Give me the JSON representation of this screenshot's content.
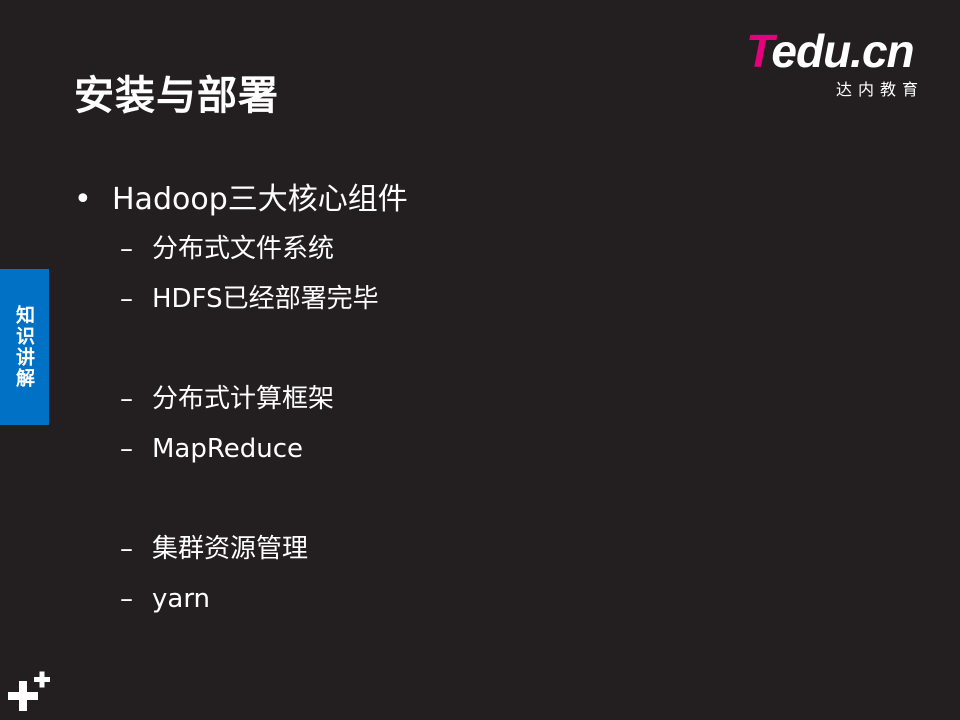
{
  "slide": {
    "title": "安装与部署",
    "side_tab": "知识讲解",
    "logo": {
      "word_first": "T",
      "word_rest": "edu.cn",
      "subtitle": "达内教育",
      "brand_color": "#e6007e"
    },
    "bullet": {
      "symbol": "•",
      "text": "Hadoop三大核心组件"
    },
    "sub_items": [
      {
        "dash": "–",
        "text": "分布式文件系统"
      },
      {
        "dash": "–",
        "text": "HDFS已经部署完毕"
      },
      {
        "dash": "–",
        "text": "分布式计算框架"
      },
      {
        "dash": "–",
        "text": "MapReduce"
      },
      {
        "dash": "–",
        "text": "集群资源管理"
      },
      {
        "dash": "–",
        "text": "yarn"
      }
    ],
    "colors": {
      "background": "#231f20",
      "side_tab": "#0071c5",
      "text": "#ffffff"
    },
    "corner_icon": "plus-icon"
  }
}
